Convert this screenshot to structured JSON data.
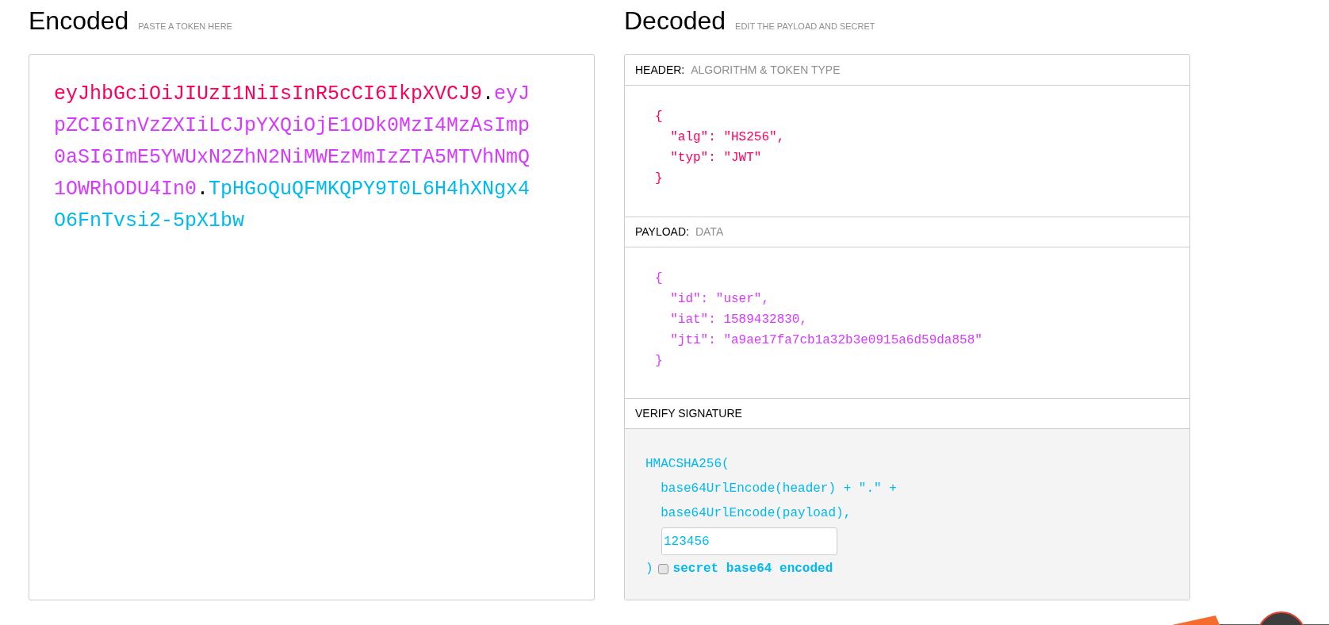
{
  "encoded": {
    "title": "Encoded",
    "hint": "PASTE A TOKEN HERE",
    "token": [
      {
        "kind": "header",
        "text": "eyJhbGciOiJIUzI1NiIsInR5cCI6IkpXVCJ9"
      },
      {
        "kind": "dot",
        "text": "."
      },
      {
        "kind": "payload",
        "text": "eyJpZCI6InVzZXIiLCJpYXQiOjE1ODk0MzI4MzAsImp0aSI6ImE5YWUxN2ZhN2NiMWEzMmIzZTA5MTVhNmQ1OWRhODU4In0"
      },
      {
        "kind": "dot",
        "text": "."
      },
      {
        "kind": "signature",
        "text": "TpHGoQuQFMKQPY9T0L6H4hXNgx4O6FnTvsi2-5pX1bw"
      }
    ]
  },
  "decoded": {
    "title": "Decoded",
    "hint": "EDIT THE PAYLOAD AND SECRET",
    "sections": [
      {
        "kind": "header",
        "label": "HEADER:",
        "hint": "ALGORITHM & TOKEN TYPE",
        "lines": [
          "{",
          "  \"alg\": \"HS256\",",
          "  \"typ\": \"JWT\"",
          "}"
        ]
      },
      {
        "kind": "payload",
        "label": "PAYLOAD:",
        "hint": "DATA",
        "lines": [
          "{",
          "  \"id\": \"user\",",
          "  \"iat\": 1589432830,",
          "  \"jti\": \"a9ae17fa7cb1a32b3e0915a6d59da858\"",
          "}"
        ]
      },
      {
        "kind": "signature",
        "label": "VERIFY SIGNATURE",
        "lines": [
          "HMACSHA256(",
          "  base64UrlEncode(header) + \".\" +",
          "  base64UrlEncode(payload),"
        ],
        "secret": "123456",
        "close": ")",
        "base64_checked": false,
        "base64_label": "secret base64 encoded"
      }
    ]
  }
}
